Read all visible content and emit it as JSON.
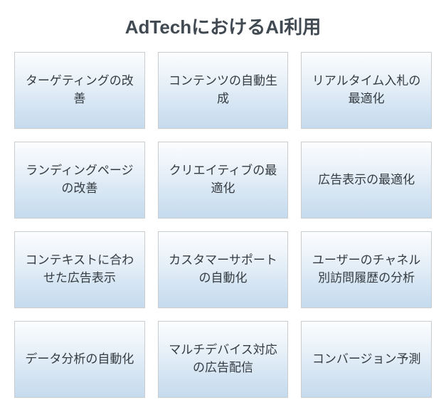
{
  "title": "AdTechにおけるAI利用",
  "tiles": [
    {
      "label": "ターゲティングの改善"
    },
    {
      "label": "コンテンツの自動生成"
    },
    {
      "label": "リアルタイム入札の最適化"
    },
    {
      "label": "ランディングページの改善"
    },
    {
      "label": "クリエイティブの最適化"
    },
    {
      "label": "広告表示の最適化"
    },
    {
      "label": "コンテキストに合わせた広告表示"
    },
    {
      "label": "カスタマーサポートの自動化"
    },
    {
      "label": "ユーザーのチャネル別訪問履歴の分析"
    },
    {
      "label": "データ分析の自動化"
    },
    {
      "label": "マルチデバイス対応の広告配信"
    },
    {
      "label": "コンバージョン予測"
    }
  ]
}
